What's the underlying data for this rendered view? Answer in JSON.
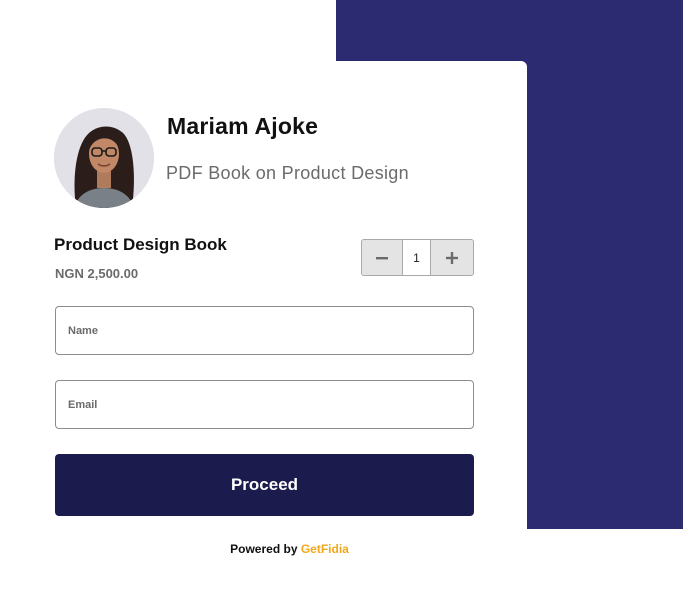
{
  "seller": {
    "name": "Mariam Ajoke",
    "product_subtitle": "PDF Book on Product Design"
  },
  "product": {
    "title": "Product Design Book",
    "price": "NGN 2,500.00",
    "quantity": "1"
  },
  "form": {
    "name_placeholder": "Name",
    "email_placeholder": "Email",
    "proceed_label": "Proceed"
  },
  "footer": {
    "powered_by": "Powered by",
    "brand": "GetFidia"
  },
  "colors": {
    "background_panel": "#2c2b72",
    "button": "#1c1b4d",
    "brand_accent": "#f2a81d"
  },
  "icons": [
    "avatar-photo",
    "minus-icon",
    "plus-icon"
  ]
}
